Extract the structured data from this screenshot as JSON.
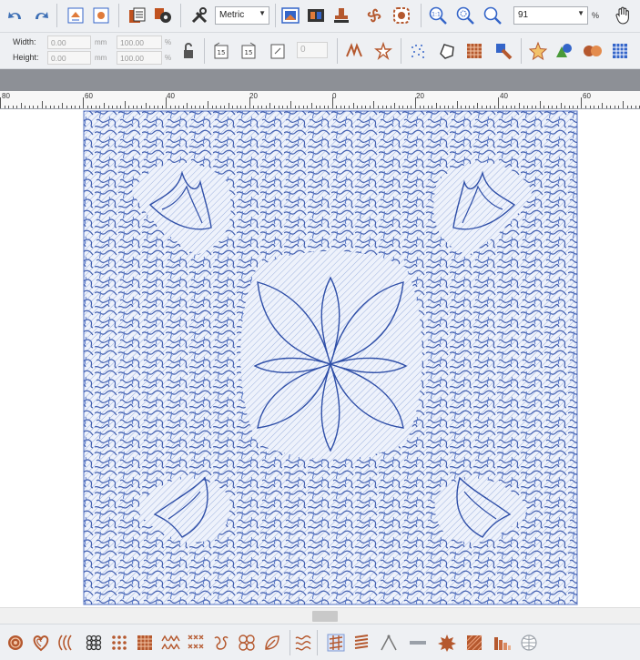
{
  "toolbar1": {
    "units_select": "Metric",
    "zoom_value": "91",
    "zoom_unit": "%"
  },
  "toolbar2": {
    "width_label": "Width:",
    "height_label": "Height:",
    "width_value": "0.00",
    "height_value": "0.00",
    "width_unit": "mm",
    "height_unit": "mm",
    "width_scale": "100.00",
    "height_scale": "100.00",
    "pct": "%",
    "count_value": "0"
  },
  "ruler": {
    "labels": [
      "80",
      "60",
      "40",
      "20",
      "0",
      "20",
      "40",
      "60"
    ]
  },
  "colors": {
    "toolbar_bg": "#eef0f3",
    "stitch_blue": "#2f4fa8",
    "fill_blue": "#7f9ad6",
    "icon_brown": "#b5582e",
    "icon_blue": "#3465c9"
  }
}
